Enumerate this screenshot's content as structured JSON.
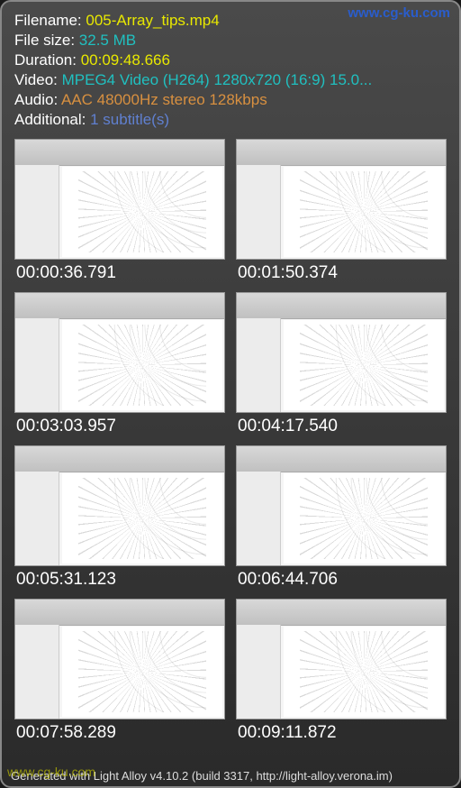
{
  "watermarks": {
    "top": "www.cg-ku.com",
    "bottom": "www.cg-ku.com"
  },
  "info": {
    "filename_label": "Filename: ",
    "filename_value": "005-Array_tips.mp4",
    "filesize_label": "File size: ",
    "filesize_value": "32.5 MB",
    "duration_label": "Duration: ",
    "duration_value": "00:09:48.666",
    "video_label": "Video: ",
    "video_value": "MPEG4 Video (H264) 1280x720 (16:9) 15.0...",
    "audio_label": "Audio: ",
    "audio_value": "AAC 48000Hz stereo 128kbps",
    "additional_label": "Additional: ",
    "additional_value": "1 subtitle(s)"
  },
  "thumbnails": [
    {
      "timestamp": "00:00:36.791"
    },
    {
      "timestamp": "00:01:50.374"
    },
    {
      "timestamp": "00:03:03.957"
    },
    {
      "timestamp": "00:04:17.540"
    },
    {
      "timestamp": "00:05:31.123"
    },
    {
      "timestamp": "00:06:44.706"
    },
    {
      "timestamp": "00:07:58.289"
    },
    {
      "timestamp": "00:09:11.872"
    }
  ],
  "footer": "Generated with Light Alloy v4.10.2 (build 3317, http://light-alloy.verona.im)"
}
